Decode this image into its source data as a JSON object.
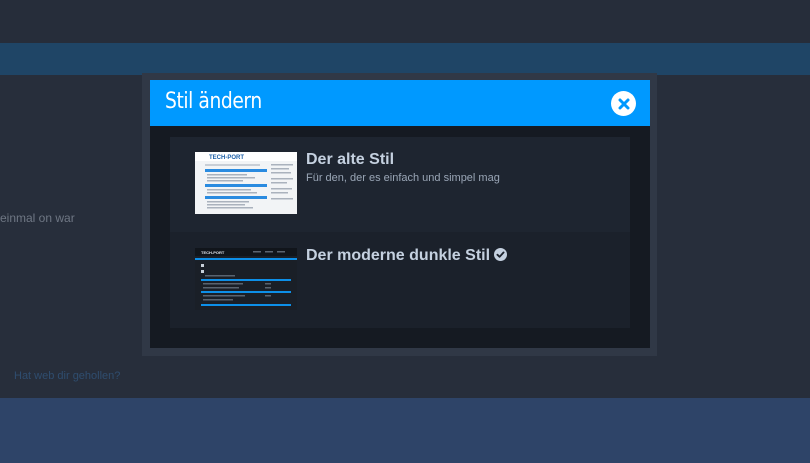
{
  "background": {
    "text_fragment": "einmal on war",
    "link_fragment": "Hat web dir gehollen?"
  },
  "modal": {
    "title": "Stil ändern",
    "close_icon": "close-circle-icon",
    "header_color": "#0099ff"
  },
  "styles": [
    {
      "name": "Der alte Stil",
      "description": "Für den, der es einfach und simpel mag",
      "thumbnail_logo": "TECH-PORT",
      "selected": false
    },
    {
      "name": "Der moderne dunkle Stil",
      "description": "",
      "thumbnail_logo": "TECH-PORT",
      "selected": true,
      "selected_icon": "check-circle-icon"
    }
  ]
}
